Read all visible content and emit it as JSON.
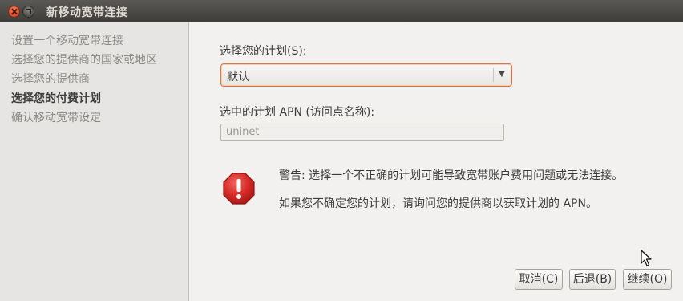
{
  "window": {
    "title": "新移动宽带连接"
  },
  "sidebar": {
    "steps": [
      {
        "label": "设置一个移动宽带连接"
      },
      {
        "label": "选择您的提供商的国家或地区"
      },
      {
        "label": "选择您的提供商"
      },
      {
        "label": "选择您的付费计划",
        "active": true
      },
      {
        "label": "确认移动宽带设定"
      }
    ]
  },
  "main": {
    "plan_label": "选择您的计划(S):",
    "plan_selected": "默认",
    "apn_label": "选中的计划 APN (访问点名称):",
    "apn_value": "uninet",
    "warning_text": "警告: 选择一个不正确的计划可能导致宽带账户费用问题或无法连接。",
    "info_text": "如果您不确定您的计划，请询问您的提供商以获取计划的 APN。"
  },
  "buttons": {
    "cancel": "取消(C)",
    "back": "后退(B)",
    "continue": "继续(O)"
  },
  "icons": {
    "close": "close-icon",
    "minimize": "minimize-icon",
    "dropdown": "chevron-down-icon",
    "warning": "warning-icon",
    "cursor": "mouse-pointer-icon"
  },
  "colors": {
    "titlebar": "#3e3d39",
    "accent_focus": "#e2763f",
    "warning_red": "#d42a25",
    "sidebar_bg": "#e6e5e3",
    "window_bg": "#f2f1f0"
  }
}
